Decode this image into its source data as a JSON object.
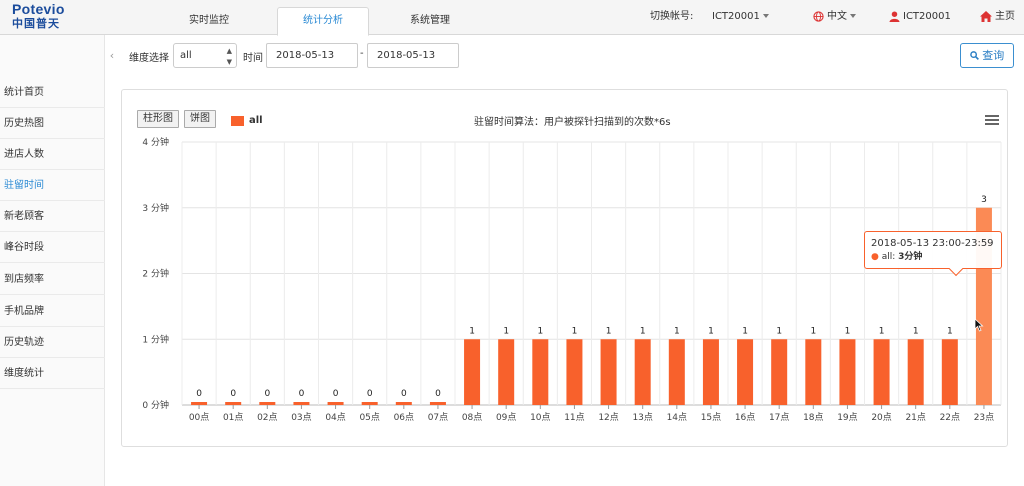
{
  "brand": {
    "name_en": "Potevio",
    "name_cn": "中国普天"
  },
  "nav": {
    "tabs": [
      "实时监控",
      "统计分析",
      "系统管理"
    ],
    "active": 1
  },
  "topright": {
    "switch_label": "切换帐号:",
    "account": "ICT20001",
    "language": "中文",
    "user": "ICT20001",
    "home": "主页"
  },
  "sidebar": {
    "items": [
      "统计首页",
      "历史热图",
      "进店人数",
      "驻留时间",
      "新老顾客",
      "峰谷时段",
      "到店频率",
      "手机品牌",
      "历史轨迹",
      "维度统计"
    ],
    "active": 3
  },
  "filter": {
    "dimension_label": "维度选择",
    "dimension_value": "all",
    "time_label": "时间",
    "start_date": "2018-05-13",
    "separator": "-",
    "end_date": "2018-05-13",
    "query_label": "查询"
  },
  "chart_toolbar": {
    "bar_btn": "柱形图",
    "pie_btn": "饼图",
    "menu_icon": "hamburger-menu-icon"
  },
  "colors": {
    "bar": "#f8612c",
    "bar_hover": "#fb8a55",
    "accent": "#2a8ad4"
  },
  "chart_data": {
    "type": "bar",
    "title": "",
    "subtitle": "驻留时间算法：用户被探针扫描到的次数*6s",
    "xlabel": "",
    "ylabel": "",
    "ylim": [
      0,
      4
    ],
    "yticks": [
      "0 分钟",
      "1 分钟",
      "2 分钟",
      "3 分钟",
      "4 分钟"
    ],
    "categories": [
      "00点",
      "01点",
      "02点",
      "03点",
      "04点",
      "05点",
      "06点",
      "07点",
      "08点",
      "09点",
      "10点",
      "11点",
      "12点",
      "13点",
      "14点",
      "15点",
      "16点",
      "17点",
      "18点",
      "19点",
      "20点",
      "21点",
      "22点",
      "23点"
    ],
    "series": [
      {
        "name": "all",
        "values": [
          0,
          0,
          0,
          0,
          0,
          0,
          0,
          0,
          1,
          1,
          1,
          1,
          1,
          1,
          1,
          1,
          1,
          1,
          1,
          1,
          1,
          1,
          1,
          3
        ]
      }
    ],
    "grid": true,
    "legend": "top-left",
    "tooltip": {
      "title": "2018-05-13 23:00-23:59",
      "series": "all",
      "value": "3分钟"
    }
  }
}
